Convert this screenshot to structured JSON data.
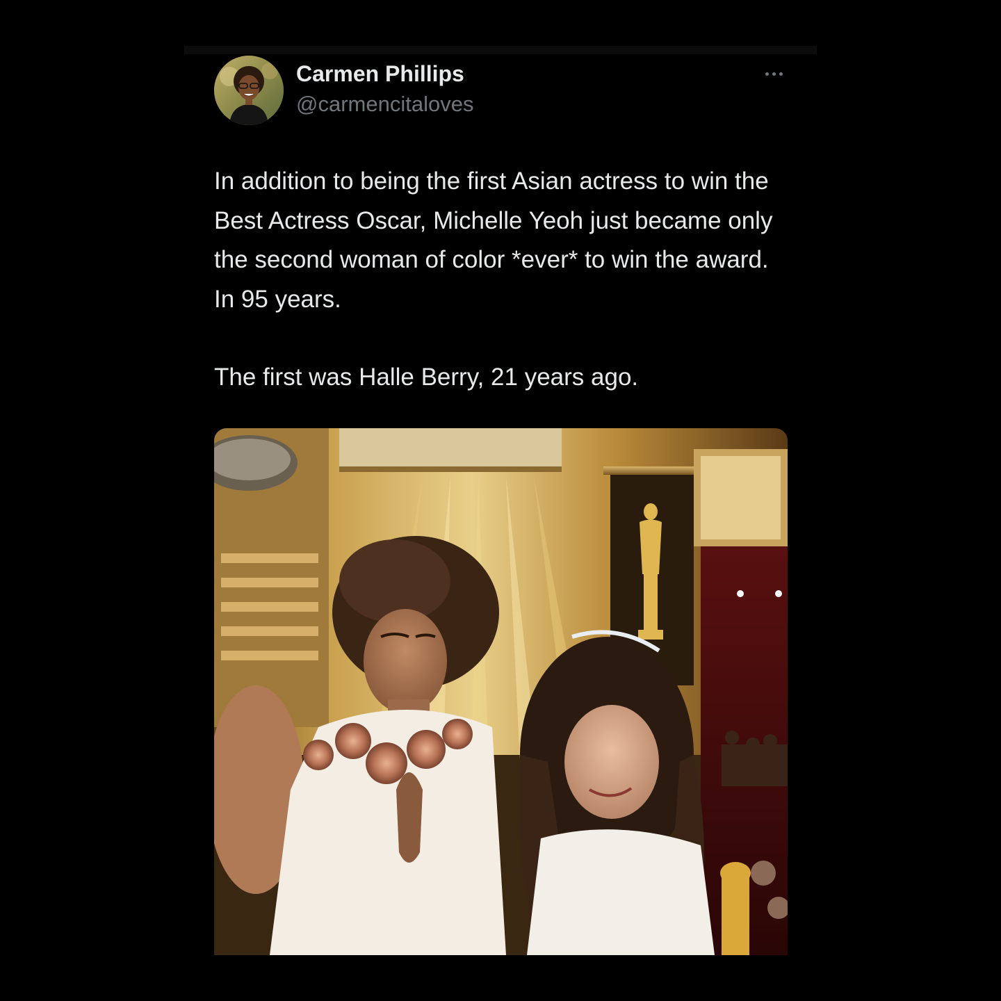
{
  "tweet": {
    "author": {
      "name": "Carmen Phillips",
      "handle": "@carmencitaloves",
      "avatar_icon": "user-avatar-photo"
    },
    "more_icon": "more-options-icon",
    "text": [
      "In addition to being the first Asian actress to win the Best Actress Oscar, Michelle Yeoh just became only the second woman of color *ever* to win the award. In 95 years.",
      "The first was Halle Berry, 21 years ago."
    ],
    "media": {
      "icon": "photo-two-women-at-oscars-stage"
    }
  },
  "colors": {
    "background": "#000000",
    "text_primary": "#e7e9ea",
    "text_secondary": "#71767b"
  }
}
